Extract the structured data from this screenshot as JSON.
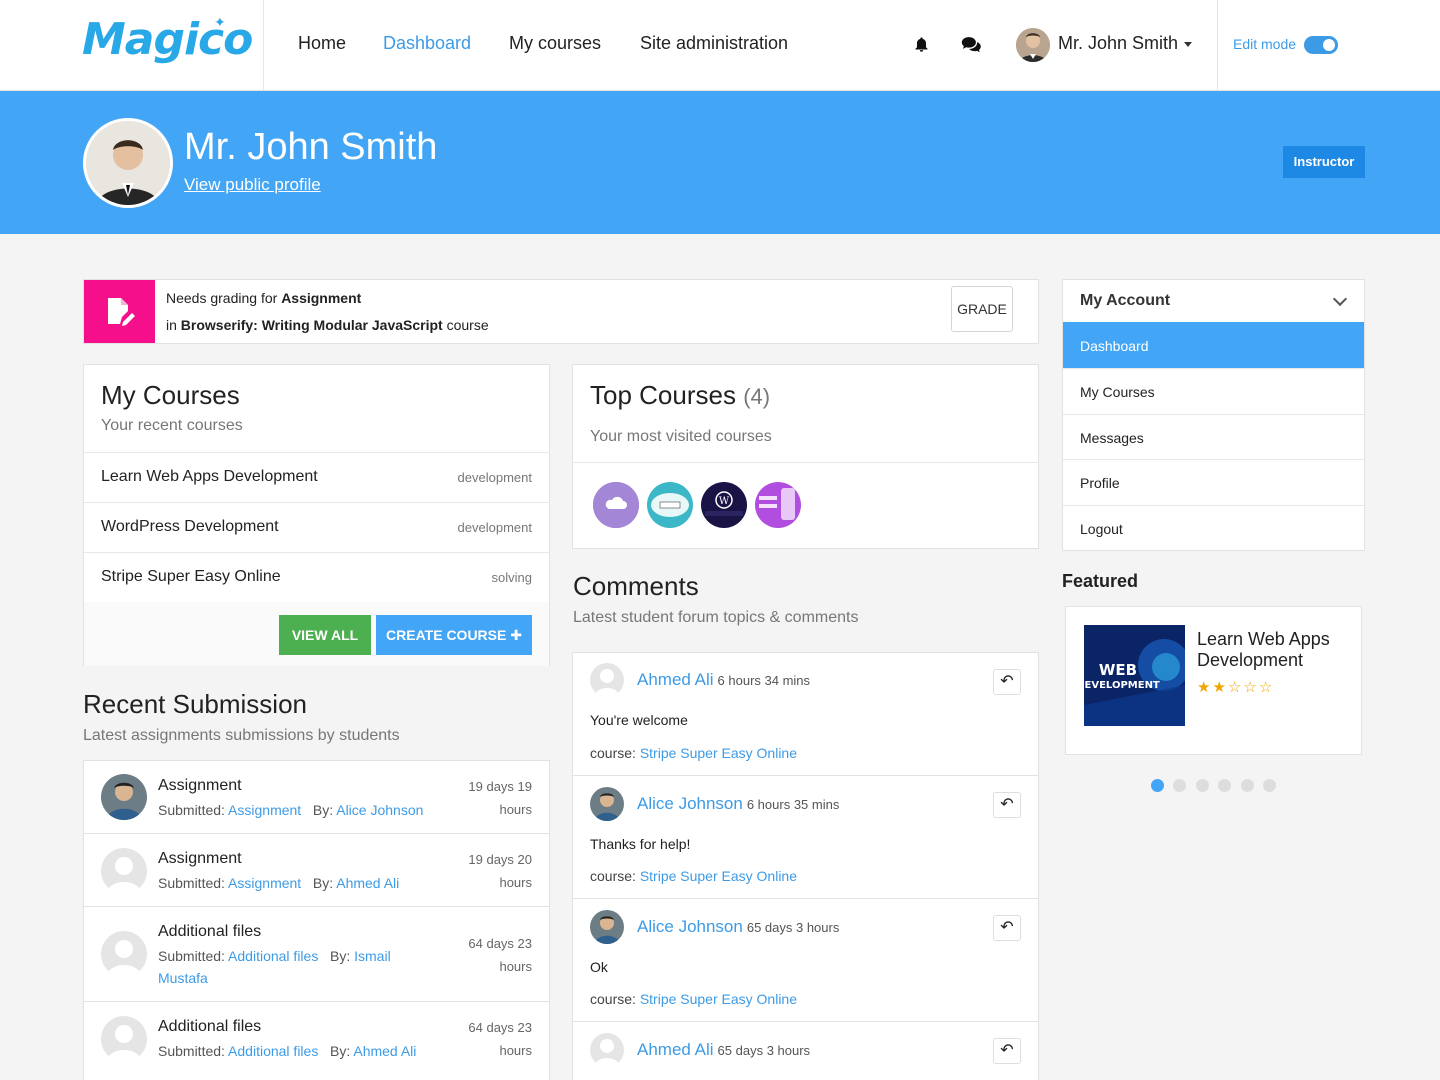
{
  "app": {
    "logo_text": "Magico"
  },
  "nav": {
    "links": [
      {
        "label": "Home"
      },
      {
        "label": "Dashboard"
      },
      {
        "label": "My courses"
      },
      {
        "label": "Site administration"
      }
    ],
    "user_name": "Mr. John Smith",
    "edit_mode_label": "Edit mode",
    "edit_mode_on": true,
    "icons": [
      "bell-icon",
      "comments-icon"
    ]
  },
  "profile": {
    "name": "Mr. John Smith",
    "public_link": "View public profile",
    "role": "Instructor"
  },
  "alert": {
    "prefix": "Needs grading for ",
    "item": "Assignment",
    "in_prefix": "in ",
    "course": "Browserify: Writing Modular JavaScript",
    "suffix": " course",
    "button": "GRADE",
    "accent": "#f50f8a"
  },
  "my_courses": {
    "title": "My Courses",
    "subtitle": "Your recent courses",
    "items": [
      {
        "name": "Learn Web Apps Development",
        "tag": "development"
      },
      {
        "name": "WordPress Development",
        "tag": "development"
      },
      {
        "name": "Stripe Super Easy Online",
        "tag": "solving"
      }
    ],
    "view_all": "VIEW ALL",
    "create": "CREATE COURSE"
  },
  "top_courses": {
    "title": "Top Courses",
    "count": "(4)",
    "subtitle": "Your most visited courses"
  },
  "recent_submission": {
    "title": "Recent Submission",
    "subtitle": "Latest assignments submissions by students",
    "items": [
      {
        "title": "Assignment",
        "submitted_label": "Submitted: ",
        "submitted": "Assignment",
        "by_label": "By: ",
        "by": "Alice Johnson",
        "time_a": "19 days 19",
        "time_b": "hours"
      },
      {
        "title": "Assignment",
        "submitted_label": "Submitted: ",
        "submitted": "Assignment",
        "by_label": "By: ",
        "by": "Ahmed Ali",
        "time_a": "19 days 20",
        "time_b": "hours"
      },
      {
        "title": "Additional files",
        "submitted_label": "Submitted: ",
        "submitted": "Additional files",
        "by_label": "By: ",
        "by": "Ismail Mustafa",
        "time_a": "64 days 23",
        "time_b": "hours"
      },
      {
        "title": "Additional files",
        "submitted_label": "Submitted: ",
        "submitted": "Additional files",
        "by_label": "By: ",
        "by": "Ahmed Ali",
        "time_a": "64 days 23",
        "time_b": "hours"
      }
    ]
  },
  "comments": {
    "title": "Comments",
    "subtitle": "Latest student forum topics & comments",
    "items": [
      {
        "name": "Ahmed Ali",
        "time": "6 hours 34 mins",
        "text": "You're welcome",
        "course_label": "course: ",
        "course": "Stripe Super Easy Online"
      },
      {
        "name": "Alice Johnson",
        "time": "6 hours 35 mins",
        "text": "Thanks for help!",
        "course_label": "course: ",
        "course": "Stripe Super Easy Online"
      },
      {
        "name": "Alice Johnson",
        "time": "65 days 3 hours",
        "text": "Ok",
        "course_label": "course: ",
        "course": "Stripe Super Easy Online"
      },
      {
        "name": "Ahmed Ali",
        "time": "65 days 3 hours"
      }
    ]
  },
  "account": {
    "title": "My Account",
    "items": [
      {
        "label": "Dashboard",
        "active": true
      },
      {
        "label": "My Courses"
      },
      {
        "label": "Messages"
      },
      {
        "label": "Profile"
      },
      {
        "label": "Logout"
      }
    ]
  },
  "featured": {
    "title": "Featured",
    "course": "Learn Web Apps Development",
    "rating": 2,
    "rating_max": 5,
    "image_text_1": "WEB",
    "image_text_2": "DEVELOPMENT",
    "dots": 6,
    "active_dot": 0
  },
  "colors": {
    "primary": "#42a5f5",
    "link": "#3d9be6",
    "success": "#4caf50",
    "alert": "#f50f8a"
  }
}
